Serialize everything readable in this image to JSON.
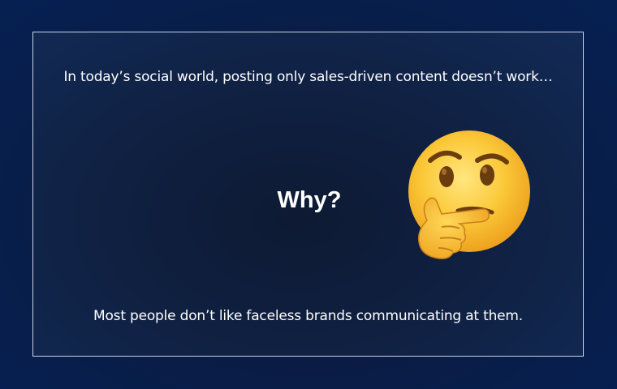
{
  "slide": {
    "top_text": "In today’s social world, posting only sales-driven content doesn’t work…",
    "headline": "Why?",
    "bottom_text": "Most people don’t like faceless brands communicating at them."
  },
  "icons": {
    "thinking_face": "thinking-face-icon"
  },
  "colors": {
    "background": "#0a1c44",
    "frame_border": "#c9d2e6",
    "text": "#ffffff",
    "emoji_face": "#f9c43a",
    "emoji_shadow": "#e89a1b"
  }
}
